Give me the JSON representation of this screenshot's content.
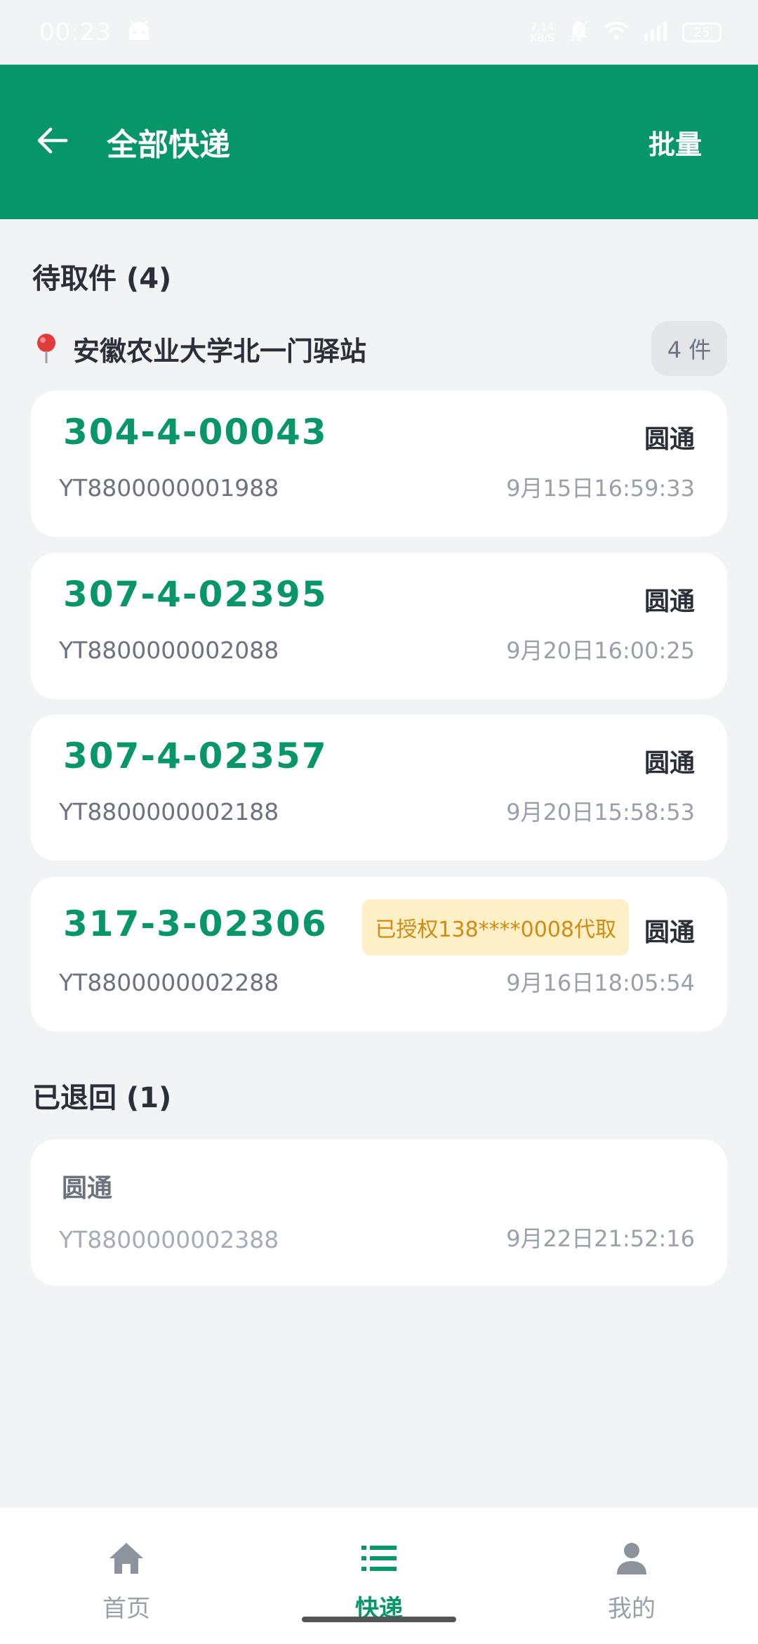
{
  "status_bar": {
    "time": "00:23",
    "net_speed_value": "7.14",
    "net_speed_unit": "KB/S",
    "battery": "25"
  },
  "app_bar": {
    "title": "全部快递",
    "batch_label": "批量"
  },
  "pending": {
    "section_title": "待取件 (4)",
    "station_name": "安徽农业大学北一门驿站",
    "station_count": "4 件",
    "items": [
      {
        "code": "304-4-00043",
        "carrier": "圆通",
        "tracking": "YT8800000001988",
        "time": "9月15日16:59:33"
      },
      {
        "code": "307-4-02395",
        "carrier": "圆通",
        "tracking": "YT8800000002088",
        "time": "9月20日16:00:25"
      },
      {
        "code": "307-4-02357",
        "carrier": "圆通",
        "tracking": "YT8800000002188",
        "time": "9月20日15:58:53"
      },
      {
        "code": "317-3-02306",
        "carrier": "圆通",
        "tracking": "YT8800000002288",
        "time": "9月16日18:05:54",
        "auth": "已授权138****0008代取"
      }
    ]
  },
  "returned": {
    "section_title": "已退回 (1)",
    "items": [
      {
        "carrier": "圆通",
        "tracking": "YT8800000002388",
        "time": "9月22日21:52:16"
      }
    ]
  },
  "nav": {
    "items": [
      {
        "label": "首页",
        "icon": "home-icon"
      },
      {
        "label": "快递",
        "icon": "list-icon"
      },
      {
        "label": "我的",
        "icon": "user-icon"
      }
    ],
    "active_index": 1
  },
  "colors": {
    "primary": "#079668",
    "background": "#f2f3f5",
    "auth_bg": "#fdf0c6",
    "auth_text": "#d48a12"
  }
}
